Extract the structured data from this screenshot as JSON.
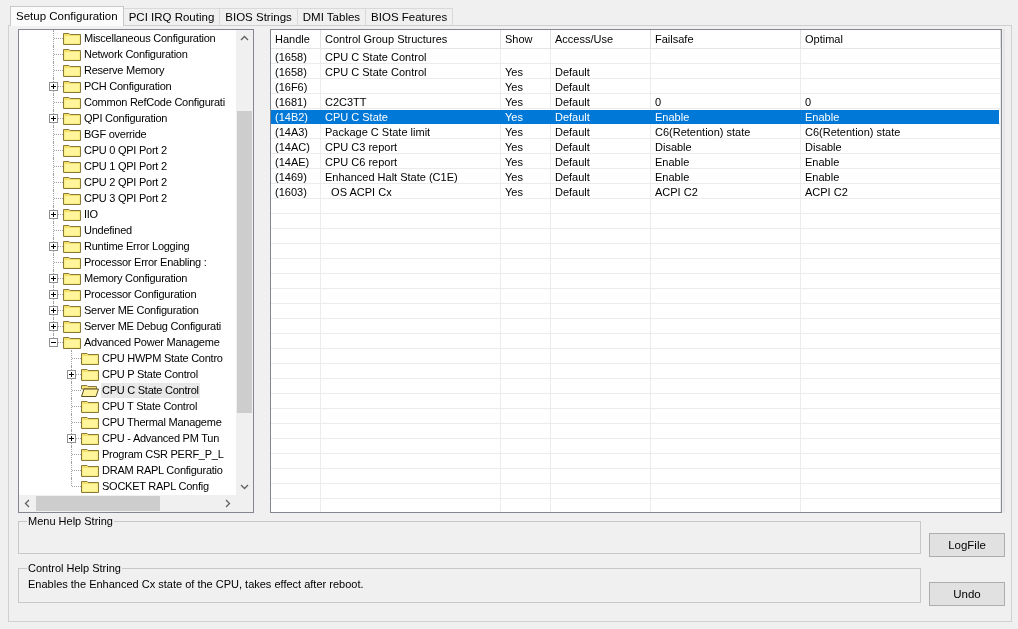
{
  "tabs": [
    {
      "label": "Setup Configuration",
      "selected": true
    },
    {
      "label": "PCI IRQ Routing",
      "selected": false
    },
    {
      "label": "BIOS Strings",
      "selected": false
    },
    {
      "label": "DMI Tables",
      "selected": false
    },
    {
      "label": "BIOS Features",
      "selected": false
    }
  ],
  "tree": {
    "items": [
      {
        "label": "Miscellaneous Configuration",
        "kind": "leaf",
        "selected": false
      },
      {
        "label": "Network Configuration",
        "kind": "leaf",
        "selected": false
      },
      {
        "label": "Reserve Memory",
        "kind": "leaf",
        "selected": false
      },
      {
        "label": "PCH Configuration",
        "kind": "node",
        "expanded": false,
        "selected": false
      },
      {
        "label": "Common RefCode Configurati",
        "kind": "leaf",
        "selected": false
      },
      {
        "label": "QPI Configuration",
        "kind": "node",
        "expanded": false,
        "selected": false
      },
      {
        "label": "BGF override",
        "kind": "leaf",
        "selected": false
      },
      {
        "label": "CPU 0 QPI Port 2",
        "kind": "leaf",
        "selected": false
      },
      {
        "label": "CPU 1 QPI Port 2",
        "kind": "leaf",
        "selected": false
      },
      {
        "label": "CPU 2 QPI Port 2",
        "kind": "leaf",
        "selected": false
      },
      {
        "label": "CPU 3 QPI Port 2",
        "kind": "leaf",
        "selected": false
      },
      {
        "label": "IIO",
        "kind": "node",
        "expanded": false,
        "selected": false
      },
      {
        "label": "Undefined",
        "kind": "leaf",
        "selected": false
      },
      {
        "label": "Runtime Error Logging",
        "kind": "node",
        "expanded": false,
        "selected": false
      },
      {
        "label": "Processor Error Enabling :",
        "kind": "leaf",
        "selected": false
      },
      {
        "label": "Memory Configuration",
        "kind": "node",
        "expanded": false,
        "selected": false
      },
      {
        "label": "Processor Configuration",
        "kind": "node",
        "expanded": false,
        "selected": false
      },
      {
        "label": "Server ME Configuration",
        "kind": "node",
        "expanded": false,
        "selected": false
      },
      {
        "label": "Server ME Debug Configurati",
        "kind": "node",
        "expanded": false,
        "selected": false
      },
      {
        "label": "Advanced Power Manageme",
        "kind": "node",
        "expanded": true,
        "selected": false,
        "children": [
          {
            "label": "CPU HWPM State Contro",
            "kind": "leaf",
            "selected": false
          },
          {
            "label": "CPU P State Control",
            "kind": "node",
            "expanded": false,
            "selected": false
          },
          {
            "label": "CPU C State Control",
            "kind": "leaf",
            "selected": true
          },
          {
            "label": "CPU T State Control",
            "kind": "leaf",
            "selected": false
          },
          {
            "label": "CPU Thermal Manageme",
            "kind": "leaf",
            "selected": false
          },
          {
            "label": "CPU - Advanced PM Tun",
            "kind": "node",
            "expanded": false,
            "selected": false
          },
          {
            "label": "Program CSR PERF_P_L",
            "kind": "leaf",
            "selected": false
          },
          {
            "label": "DRAM RAPL Configuratio",
            "kind": "leaf",
            "selected": false
          },
          {
            "label": "SOCKET RAPL Config",
            "kind": "leaf",
            "selected": false
          }
        ]
      }
    ]
  },
  "table": {
    "columns": [
      "Handle",
      "Control Group Structures",
      "Show",
      "Access/Use",
      "Failsafe",
      "Optimal"
    ],
    "rows": [
      {
        "handle": "(1658)",
        "structure": "CPU C State Control",
        "selected": false
      },
      {
        "handle": "(1658)",
        "structure": "CPU C State Control",
        "show": "Yes",
        "access": "Default",
        "selected": false
      },
      {
        "handle": "(16F6)",
        "show": "Yes",
        "access": "Default",
        "selected": false
      },
      {
        "handle": "(1681)",
        "structure": "C2C3TT",
        "show": "Yes",
        "access": "Default",
        "failsafe": "0",
        "optimal": "0",
        "selected": false
      },
      {
        "handle": "(14B2)",
        "structure": "CPU C State",
        "show": "Yes",
        "access": "Default",
        "failsafe": "Enable",
        "optimal": "Enable",
        "selected": true
      },
      {
        "handle": "(14A3)",
        "structure": "Package C State limit",
        "show": "Yes",
        "access": "Default",
        "failsafe": "C6(Retention) state",
        "optimal": "C6(Retention) state",
        "selected": false
      },
      {
        "handle": "(14AC)",
        "structure": "CPU C3 report",
        "show": "Yes",
        "access": "Default",
        "failsafe": "Disable",
        "optimal": "Disable",
        "selected": false
      },
      {
        "handle": "(14AE)",
        "structure": "CPU C6 report",
        "show": "Yes",
        "access": "Default",
        "failsafe": "Enable",
        "optimal": "Enable",
        "selected": false
      },
      {
        "handle": "(1469)",
        "structure": "Enhanced Halt State (C1E)",
        "show": "Yes",
        "access": "Default",
        "failsafe": "Enable",
        "optimal": "Enable",
        "selected": false
      },
      {
        "handle": "(1603)",
        "structure": "  OS ACPI Cx",
        "show": "Yes",
        "access": "Default",
        "failsafe": "ACPI C2",
        "optimal": "ACPI C2",
        "selected": false
      }
    ]
  },
  "menu_help": {
    "label": "Menu Help String"
  },
  "control_help": {
    "label": "Control Help String",
    "text": "Enables the Enhanced Cx state of the CPU, takes effect after reboot."
  },
  "buttons": [
    "LogFile",
    "Undo"
  ]
}
